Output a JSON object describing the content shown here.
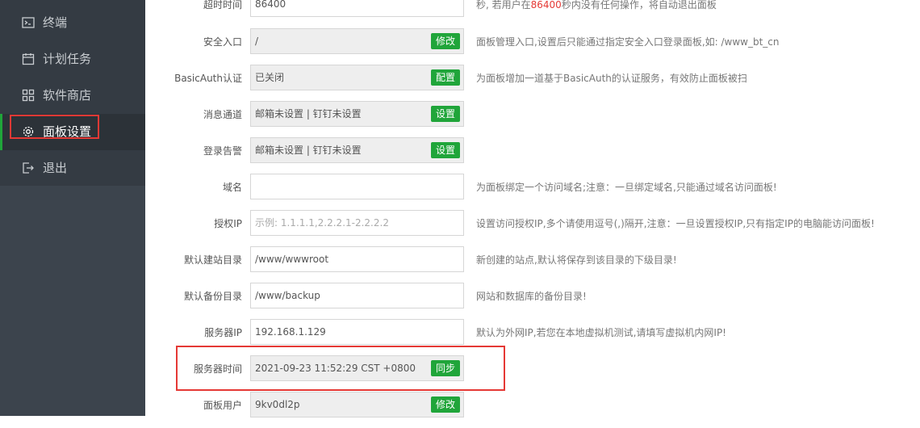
{
  "sidebar": {
    "items": [
      {
        "label": "终端",
        "icon": "terminal-icon"
      },
      {
        "label": "计划任务",
        "icon": "calendar-icon"
      },
      {
        "label": "软件商店",
        "icon": "grid-icon"
      },
      {
        "label": "面板设置",
        "icon": "gear-icon",
        "active": true
      },
      {
        "label": "退出",
        "icon": "logout-icon"
      }
    ]
  },
  "settings": {
    "timeout": {
      "label": "超时时间",
      "value": "86400",
      "desc_pre": "秒, 若用户在",
      "desc_hl": "86400",
      "desc_post": "秒内没有任何操作，将自动退出面板"
    },
    "security_entry": {
      "label": "安全入口",
      "value": "/",
      "button": "修改",
      "desc": "面板管理入口,设置后只能通过指定安全入口登录面板,如: /www_bt_cn"
    },
    "basic_auth": {
      "label": "BasicAuth认证",
      "value": "已关闭",
      "button": "配置",
      "desc": "为面板增加一道基于BasicAuth的认证服务，有效防止面板被扫"
    },
    "message_channel": {
      "label": "消息通道",
      "value": "邮箱未设置 | 钉钉未设置",
      "button": "设置"
    },
    "login_alert": {
      "label": "登录告警",
      "value": "邮箱未设置 | 钉钉未设置",
      "button": "设置"
    },
    "domain": {
      "label": "域名",
      "value": "",
      "desc": "为面板绑定一个访问域名;注意：一旦绑定域名,只能通过域名访问面板!"
    },
    "auth_ip": {
      "label": "授权IP",
      "placeholder": "示例: 1.1.1.1,2.2.2.1-2.2.2.2",
      "desc": "设置访问授权IP,多个请使用逗号(,)隔开,注意：一旦设置授权IP,只有指定IP的电脑能访问面板!"
    },
    "site_dir": {
      "label": "默认建站目录",
      "value": "/www/wwwroot",
      "desc": "新创建的站点,默认将保存到该目录的下级目录!"
    },
    "backup_dir": {
      "label": "默认备份目录",
      "value": "/www/backup",
      "desc": "网站和数据库的备份目录!"
    },
    "server_ip": {
      "label": "服务器IP",
      "value": "192.168.1.129",
      "desc": "默认为外网IP,若您在本地虚拟机测试,请填写虚拟机内网IP!"
    },
    "server_time": {
      "label": "服务器时间",
      "value": "2021-09-23 11:52:29 CST +0800",
      "button": "同步"
    },
    "panel_user": {
      "label": "面板用户",
      "value": "9kv0dl2p",
      "button": "修改"
    }
  },
  "colors": {
    "accent": "#20a53a",
    "highlight": "#e53935",
    "sidebar": "#3c444d"
  }
}
